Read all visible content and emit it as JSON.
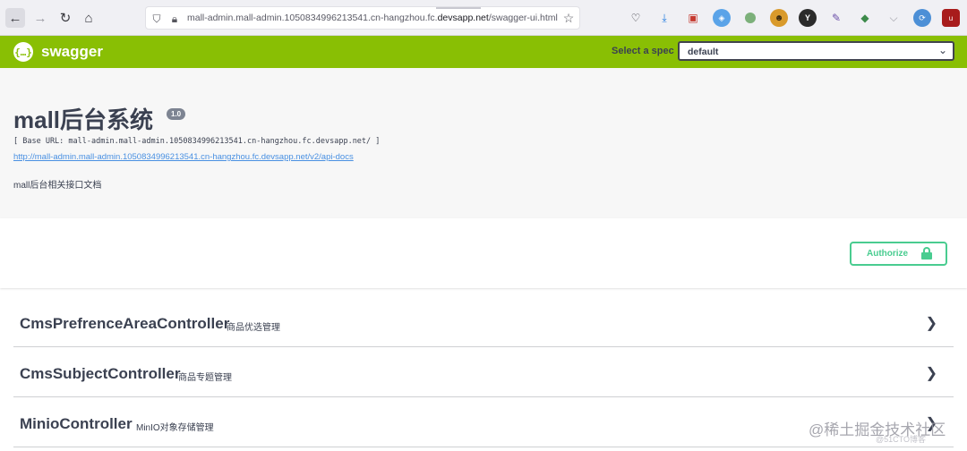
{
  "browser": {
    "url_prefix": "mall-admin.mall-admin.1050834996213541.cn-hangzhou.fc.",
    "url_domain": "devsapp.net",
    "url_suffix": "/swagger-ui.html",
    "icons": {
      "back": "arrow-left-icon",
      "forward": "arrow-right-icon",
      "reload": "reload-icon",
      "home": "home-icon",
      "shield": "shield-icon",
      "lock": "lock-icon",
      "bookmark": "star-icon"
    },
    "extensions": [
      "pocket-icon",
      "download-icon",
      "clipboard-icon",
      "compass-icon",
      "circle-extension-icon",
      "monkey-icon",
      "y-extension-icon",
      "pen-icon",
      "puzzle-icon",
      "chevron-icon",
      "sync-icon",
      "ublock-icon",
      "question-icon",
      "menu-icon"
    ]
  },
  "topbar": {
    "logo_text": "swagger",
    "logo_glyph": "{…}",
    "spec_label": "Select a spec",
    "spec_value": "default",
    "color": "#89bf04"
  },
  "info": {
    "title": "mall后台系统",
    "version": "1.0",
    "base_url": "[ Base URL: mall-admin.mall-admin.1050834996213541.cn-hangzhou.fc.devsapp.net/ ]",
    "api_docs_link": "http://mall-admin.mall-admin.1050834996213541.cn-hangzhou.fc.devsapp.net/v2/api-docs",
    "description": "mall后台相关接口文档"
  },
  "authorize": {
    "label": "Authorize",
    "color": "#49cc90"
  },
  "controllers": [
    {
      "name": "CmsPrefrenceAreaController",
      "description": "商品优选管理"
    },
    {
      "name": "CmsSubjectController",
      "description": "商品专题管理"
    },
    {
      "name": "MinioController",
      "description": "MinIO对象存储管理"
    }
  ],
  "watermark": {
    "text": "@稀土掘金技术社区",
    "sub_text": "@51CTO博客"
  }
}
